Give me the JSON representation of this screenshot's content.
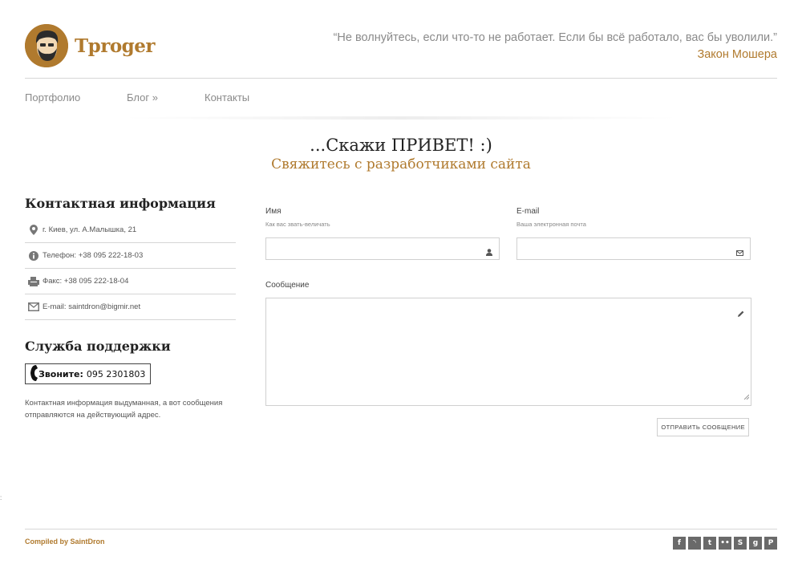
{
  "brand": {
    "name": "Tproger",
    "color": "#b07a2e"
  },
  "quote": {
    "text": "“Не волнуйтесь, если что-то не работает. Если бы всё работало, вас бы уволили.”",
    "author": "Закон Мошера"
  },
  "nav": {
    "items": [
      {
        "label": "Портфолио"
      },
      {
        "label": "Блог »"
      },
      {
        "label": "Контакты"
      }
    ]
  },
  "hero": {
    "title": "...Скажи ПРИВЕТ! :)",
    "subtitle": "Свяжитесь с разработчиками сайта"
  },
  "contact": {
    "title": "Контактная информация",
    "items": [
      {
        "icon": "map-pin-icon",
        "text": "г. Киев, ул. А.Малышка, 21"
      },
      {
        "icon": "info-icon",
        "text": "Телефон: +38 095 222-18-03"
      },
      {
        "icon": "fax-icon",
        "text": "Факс: +38 095 222-18-04"
      },
      {
        "icon": "envelope-icon",
        "text": "E-mail: saintdron@bigmir.net"
      }
    ]
  },
  "support": {
    "title": "Служба поддержки",
    "call_label": "Звоните:",
    "call_number": "095 2301803",
    "note": "Контактная информация выдуманная, а вот сообщения отправляются на действующий адрес."
  },
  "form": {
    "name_label": "Имя",
    "name_hint": "Как вас звать-величать",
    "name_value": "",
    "email_label": "E-mail",
    "email_hint": "Ваша электронная почта",
    "email_value": "",
    "message_label": "Сообщение",
    "message_value": "",
    "submit_label": "ОТПРАВИТЬ СООБЩЕНИЕ"
  },
  "side_mark": ":",
  "footer": {
    "credits": "Compiled by SaintDron",
    "social": [
      {
        "icon": "facebook-icon",
        "glyph": "f"
      },
      {
        "icon": "rss-icon",
        "glyph": "◝"
      },
      {
        "icon": "twitter-icon",
        "glyph": "t"
      },
      {
        "icon": "flickr-icon",
        "glyph": "••"
      },
      {
        "icon": "skype-icon",
        "glyph": "S"
      },
      {
        "icon": "google-plus-icon",
        "glyph": "g"
      },
      {
        "icon": "pinterest-icon",
        "glyph": "P"
      }
    ]
  }
}
